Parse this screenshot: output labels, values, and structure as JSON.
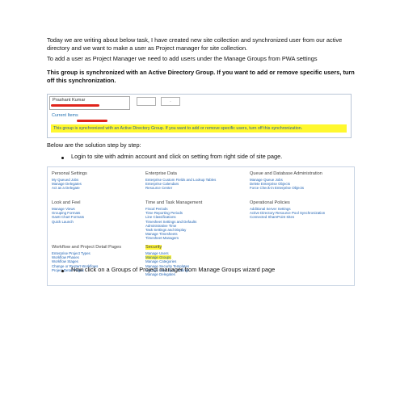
{
  "intro": {
    "para1": "Today we are writing about below task, I have created new site collection and synchronized user from our active directory and we want to make a  user as Project manager for site collection.",
    "para2": "To add a user as Project Manager we need to add users under the Manage Groups from PWA settings",
    "bold_para": "This group is synchronized with an Active Directory Group.  If you want to add or remove specific users, turn off this synchronization."
  },
  "screenshot1": {
    "name_value": "Prashant Kumar",
    "box_a": "",
    "box_b": ".",
    "current_items_label": "Current Items",
    "banner_text": "This group is synchronized with an Active Directory Group.  If you want to add or remove specific users, turn off this synchronization."
  },
  "steps": {
    "heading": "Below are the solution step by step:",
    "step1": "Login to site with admin account and click on setting from right side of site page.",
    "step2": "Now click on a Groups of Project manager from Manage Groups wizard page"
  },
  "settings": {
    "personal": {
      "title": "Personal Settings",
      "links": [
        "My Queued Jobs",
        "Manage Delegates",
        "Act as a Delegate"
      ]
    },
    "enterprise": {
      "title": "Enterprise Data",
      "links": [
        "Enterprise Custom Fields and Lookup Tables",
        "Enterprise Calendars",
        "Resource Center"
      ]
    },
    "queue": {
      "title": "Queue and Database Administration",
      "links": [
        "Manage Queue Jobs",
        "Delete Enterprise Objects",
        "Force Check-in Enterprise Objects"
      ]
    },
    "look": {
      "title": "Look and Feel",
      "links": [
        "Manage Views",
        "Grouping Formats",
        "Gantt Chart Formats",
        "Quick Launch"
      ]
    },
    "time": {
      "title": "Time and Task Management",
      "links": [
        "Fiscal Periods",
        "Time Reporting Periods",
        "Line Classifications",
        "Timesheet Settings and Defaults",
        "Administrative Time",
        "Task Settings and Display",
        "Manage Timesheets",
        "Timesheet Managers"
      ]
    },
    "ops": {
      "title": "Operational Policies",
      "links": [
        "Additional Server Settings",
        "Active Directory Resource Pool Synchronization",
        "Connected SharePoint Sites"
      ]
    },
    "workflow": {
      "title": "Workflow and Project Detail Pages",
      "links": [
        "Enterprise Project Types",
        "Workflow Phases",
        "Workflow Stages",
        "Change or Restart Workflows",
        "Project Detail Pages"
      ]
    },
    "security": {
      "title": "Security",
      "links": [
        "Manage Users",
        "Manage Groups",
        "Manage Categories",
        "Manage Security Templates",
        "Manage User Sync Settings",
        "Manage Delegates"
      ]
    }
  },
  "colors": {
    "highlight": "#fff63a",
    "link": "#1f62b3",
    "red_mark": "#e0241b"
  }
}
